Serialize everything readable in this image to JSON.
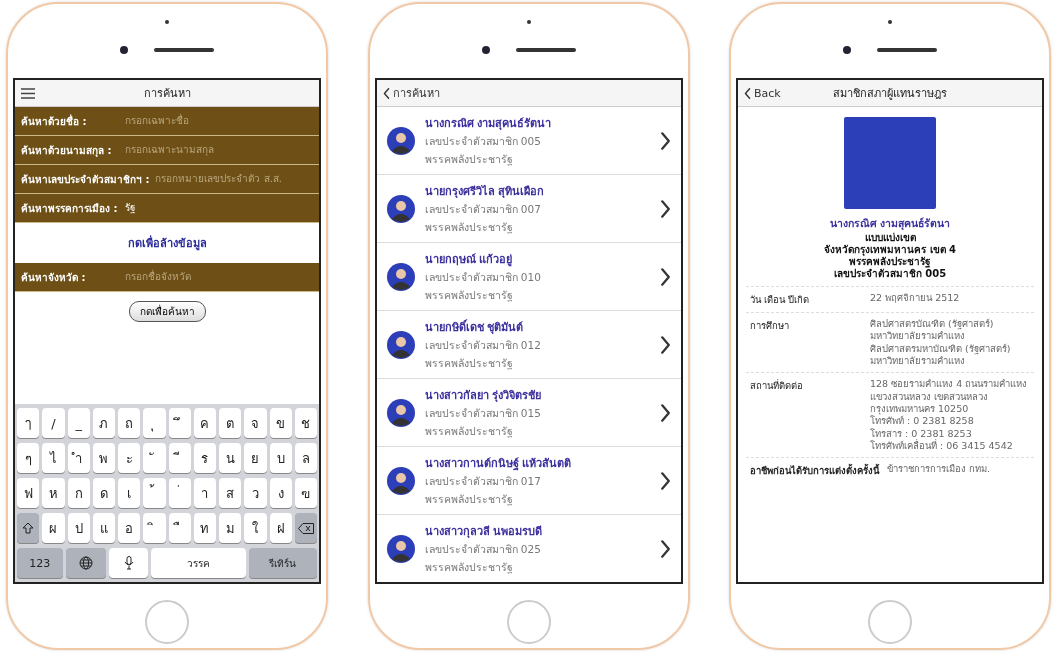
{
  "search_screen": {
    "title": "การค้นหา",
    "fields": [
      {
        "label": "ค้นหาด้วยชื่อ :",
        "placeholder": "กรอกเฉพาะชื่อ"
      },
      {
        "label": "ค้นหาด้วยนามสกุล :",
        "placeholder": "กรอกเฉพาะนามสกุล"
      },
      {
        "label": "ค้นหาเลขประจำตัวสมาชิกฯ :",
        "placeholder": "กรอกหมายเลขประจำตัว ส.ส."
      },
      {
        "label": "ค้นหาพรรคการเมือง :",
        "value": "รัฐ"
      }
    ],
    "clear_link": "กดเพื่อล้างข้อมูล",
    "province_field": {
      "label": "ค้นหาจังหวัด :",
      "placeholder": "กรอกชื่อจังหวัด"
    },
    "search_button": "กดเพื่อค้นหา",
    "keyboard": [
      [
        {
          "kind": "char",
          "label": "ๅ"
        },
        {
          "kind": "char",
          "label": "/"
        },
        {
          "kind": "char",
          "label": "_"
        },
        {
          "kind": "char",
          "label": "ภ"
        },
        {
          "kind": "char",
          "label": "ถ"
        },
        {
          "kind": "char",
          "label": "ุ"
        },
        {
          "kind": "char",
          "label": "ึ"
        },
        {
          "kind": "char",
          "label": "ค"
        },
        {
          "kind": "char",
          "label": "ต"
        },
        {
          "kind": "char",
          "label": "จ"
        },
        {
          "kind": "char",
          "label": "ข"
        },
        {
          "kind": "char",
          "label": "ช"
        }
      ],
      [
        {
          "kind": "char",
          "label": "ๆ"
        },
        {
          "kind": "char",
          "label": "ไ"
        },
        {
          "kind": "char",
          "label": "ำ"
        },
        {
          "kind": "char",
          "label": "พ"
        },
        {
          "kind": "char",
          "label": "ะ"
        },
        {
          "kind": "char",
          "label": "ั"
        },
        {
          "kind": "char",
          "label": "ี"
        },
        {
          "kind": "char",
          "label": "ร"
        },
        {
          "kind": "char",
          "label": "น"
        },
        {
          "kind": "char",
          "label": "ย"
        },
        {
          "kind": "char",
          "label": "บ"
        },
        {
          "kind": "char",
          "label": "ล"
        }
      ],
      [
        {
          "kind": "char",
          "label": "ฟ"
        },
        {
          "kind": "char",
          "label": "ห"
        },
        {
          "kind": "char",
          "label": "ก"
        },
        {
          "kind": "char",
          "label": "ด"
        },
        {
          "kind": "char",
          "label": "เ"
        },
        {
          "kind": "char",
          "label": "้"
        },
        {
          "kind": "char",
          "label": "่"
        },
        {
          "kind": "char",
          "label": "า"
        },
        {
          "kind": "char",
          "label": "ส"
        },
        {
          "kind": "char",
          "label": "ว"
        },
        {
          "kind": "char",
          "label": "ง"
        },
        {
          "kind": "char",
          "label": "ฃ"
        }
      ],
      [
        {
          "kind": "shift"
        },
        {
          "kind": "char",
          "label": "ผ"
        },
        {
          "kind": "char",
          "label": "ป"
        },
        {
          "kind": "char",
          "label": "แ"
        },
        {
          "kind": "char",
          "label": "อ"
        },
        {
          "kind": "char",
          "label": "ิ"
        },
        {
          "kind": "char",
          "label": "ื"
        },
        {
          "kind": "char",
          "label": "ท"
        },
        {
          "kind": "char",
          "label": "ม"
        },
        {
          "kind": "char",
          "label": "ใ"
        },
        {
          "kind": "char",
          "label": "ฝ"
        },
        {
          "kind": "backspace"
        }
      ],
      [
        {
          "kind": "mode",
          "label": "123"
        },
        {
          "kind": "globe"
        },
        {
          "kind": "mic"
        },
        {
          "kind": "space",
          "label": "วรรค"
        },
        {
          "kind": "return",
          "label": "รีเทิร์น"
        }
      ]
    ]
  },
  "results_screen": {
    "back": "การค้นหา",
    "items": [
      {
        "name": "นางกรณิศ งามสุคนธ์รัตนา",
        "member_no": "เลขประจำตัวสมาชิก 005",
        "party": "พรรคพลังประชารัฐ"
      },
      {
        "name": "นายกรุงศรีวิไล สุทินเผือก",
        "member_no": "เลขประจำตัวสมาชิก 007",
        "party": "พรรคพลังประชารัฐ"
      },
      {
        "name": "นายกฤษณ์ แก้วอยู่",
        "member_no": "เลขประจำตัวสมาชิก 010",
        "party": "พรรคพลังประชารัฐ"
      },
      {
        "name": "นายกษิดิ์เดช ชุติมันต์",
        "member_no": "เลขประจำตัวสมาชิก 012",
        "party": "พรรคพลังประชารัฐ"
      },
      {
        "name": "นางสาวกัลยา รุ่งวิจิตรชัย",
        "member_no": "เลขประจำตัวสมาชิก 015",
        "party": "พรรคพลังประชารัฐ"
      },
      {
        "name": "นางสาวกานต์กนิษฐ์ แห้วสันตติ",
        "member_no": "เลขประจำตัวสมาชิก 017",
        "party": "พรรคพลังประชารัฐ"
      },
      {
        "name": "นางสาวกุลวลี นพอมรบดี",
        "member_no": "เลขประจำตัวสมาชิก 025",
        "party": "พรรคพลังประชารัฐ"
      }
    ]
  },
  "detail_screen": {
    "back": "Back",
    "title": "สมาชิกสภาผู้แทนราษฎร",
    "name": "นางกรณิศ งามสุคนธ์รัตนา",
    "summary": [
      "แบบแบ่งเขต",
      "จังหวัดกรุงเทพมหานคร เขต 4",
      "พรรคพลังประชารัฐ",
      "เลขประจำตัวสมาชิก 005"
    ],
    "rows": [
      {
        "label": "วัน เดือน ปีเกิด",
        "lines": [
          "22 พฤศจิกายน 2512"
        ]
      },
      {
        "label": "การศึกษา",
        "lines": [
          "ศิลปศาสตรบัณฑิต (รัฐศาสตร์)",
          "มหาวิทยาลัยรามคำแหง",
          "ศิลปศาสตรมหาบัณฑิต (รัฐศาสตร์) มหาวิทยาลัยรามคำแหง"
        ]
      },
      {
        "label": "สถานที่ติดต่อ",
        "lines": [
          "128 ซอยรามคำแหง 4 ถนนรามคำแหง",
          "แขวงสวนหลวง เขตสวนหลวง",
          "กรุงเทพมหานคร 10250",
          "โทรศัพท์ : 0 2381 8258",
          "โทรสาร : 0 2381 8253",
          "โทรศัพท์เคลื่อนที่ : 06 3415 4542"
        ]
      },
      {
        "label": "อาชีพก่อนได้รับการแต่งตั้งครั้งนี้",
        "lines": [
          "ข้าราชการการเมือง กทม."
        ]
      }
    ]
  }
}
